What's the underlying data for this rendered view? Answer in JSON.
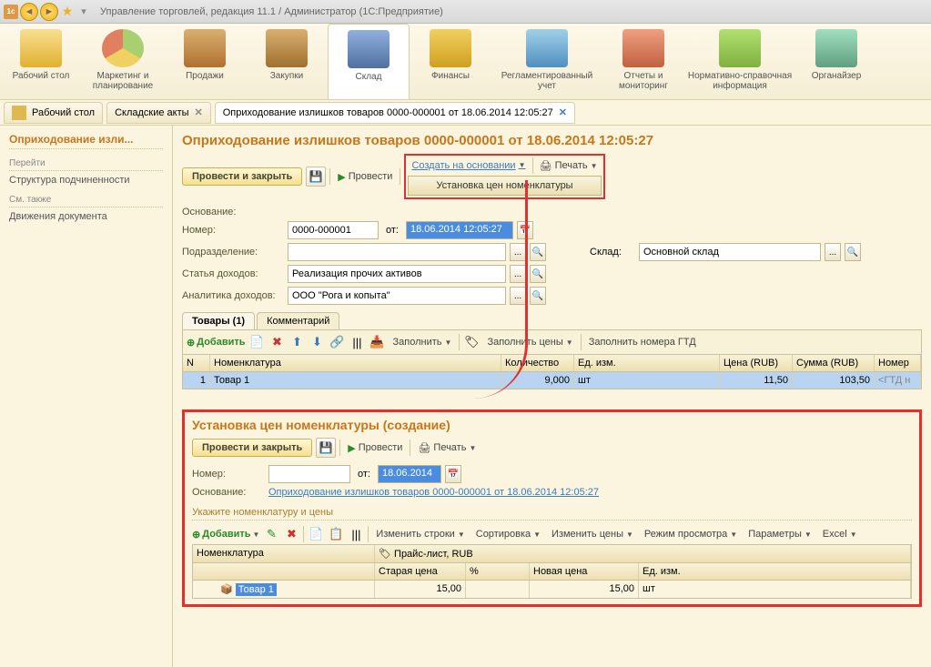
{
  "window": {
    "title": "Управление торговлей, редакция 11.1 / Администратор  (1С:Предприятие)"
  },
  "mainToolbar": [
    {
      "label": "Рабочий стол",
      "color": "#f0c850"
    },
    {
      "label": "Маркетинг и планирование",
      "color": "#a8d070"
    },
    {
      "label": "Продажи",
      "color": "#d09050"
    },
    {
      "label": "Закупки",
      "color": "#c8a060"
    },
    {
      "label": "Склад",
      "color": "#6090d0",
      "active": true
    },
    {
      "label": "Финансы",
      "color": "#e0c040"
    },
    {
      "label": "Регламентированный учет",
      "color": "#70b0d0"
    },
    {
      "label": "Отчеты и мониторинг",
      "color": "#d07050"
    },
    {
      "label": "Нормативно-справочная информация",
      "color": "#90c050"
    },
    {
      "label": "Органайзер",
      "color": "#80c090"
    }
  ],
  "tabs": [
    {
      "label": "Рабочий стол"
    },
    {
      "label": "Складские акты",
      "close": true
    },
    {
      "label": "Оприходование излишков товаров 0000-000001 от 18.06.2014 12:05:27",
      "close": true,
      "active": true
    }
  ],
  "sidebar": {
    "title": "Оприходование изли...",
    "sect1": "Перейти",
    "link1": "Структура подчиненности",
    "sect2": "См. также",
    "link2": "Движения документа"
  },
  "page": {
    "title": "Оприходование излишков товаров 0000-000001 от 18.06.2014 12:05:27",
    "btn_process_close": "Провести и закрыть",
    "btn_process": "Провести",
    "btn_create_based": "Создать на основании",
    "btn_print": "Печать",
    "menu_set_prices": "Установка цен номенклатуры",
    "lbl_basis": "Основание:",
    "lbl_number": "Номер:",
    "val_number": "0000-000001",
    "lbl_from": "от:",
    "val_date": "18.06.2014 12:05:27",
    "lbl_subdiv": "Подразделение:",
    "lbl_warehouse": "Склад:",
    "val_warehouse": "Основной склад",
    "lbl_income_item": "Статья доходов:",
    "val_income_item": "Реализация прочих активов",
    "lbl_analytics": "Аналитика доходов:",
    "val_analytics": "ООО \"Рога и копыта\"",
    "tab_goods": "Товары (1)",
    "tab_comment": "Комментарий",
    "btn_add": "Добавить",
    "btn_fill": "Заполнить",
    "btn_fill_prices": "Заполнить цены",
    "btn_fill_gtd": "Заполнить номера ГТД",
    "grid_cols": {
      "n": "N",
      "nomen": "Номенклатура",
      "qty": "Количество",
      "unit": "Ед. изм.",
      "price": "Цена (RUB)",
      "sum": "Сумма (RUB)",
      "gtd": "Номер"
    },
    "grid_row": {
      "n": "1",
      "nomen": "Товар 1",
      "qty": "9,000",
      "unit": "шт",
      "price": "11,50",
      "sum": "103,50",
      "gtd": "<ГТД н"
    }
  },
  "panel2": {
    "title": "Установка цен номенклатуры (создание)",
    "btn_process_close": "Провести и закрыть",
    "btn_process": "Провести",
    "btn_print": "Печать",
    "lbl_number": "Номер:",
    "lbl_from": "от:",
    "val_date": "18.06.2014",
    "lbl_basis": "Основание:",
    "val_basis": "Оприходование излишков товаров 0000-000001 от 18.06.2014 12:05:27",
    "section": "Укажите номенклатуру и цены",
    "btn_add": "Добавить",
    "btn_change_rows": "Изменить строки",
    "btn_sort": "Сортировка",
    "btn_change_prices": "Изменить цены",
    "btn_view_mode": "Режим просмотра",
    "btn_params": "Параметры",
    "btn_excel": "Excel",
    "col_nomen": "Номенклатура",
    "col_price_list": "Прайс-лист, RUB",
    "col_old": "Старая цена",
    "col_pct": "%",
    "col_new": "Новая цена",
    "col_unit": "Ед. изм.",
    "row": {
      "nomen": "Товар 1",
      "old": "15,00",
      "pct": "",
      "new": "15,00",
      "unit": "шт"
    }
  }
}
